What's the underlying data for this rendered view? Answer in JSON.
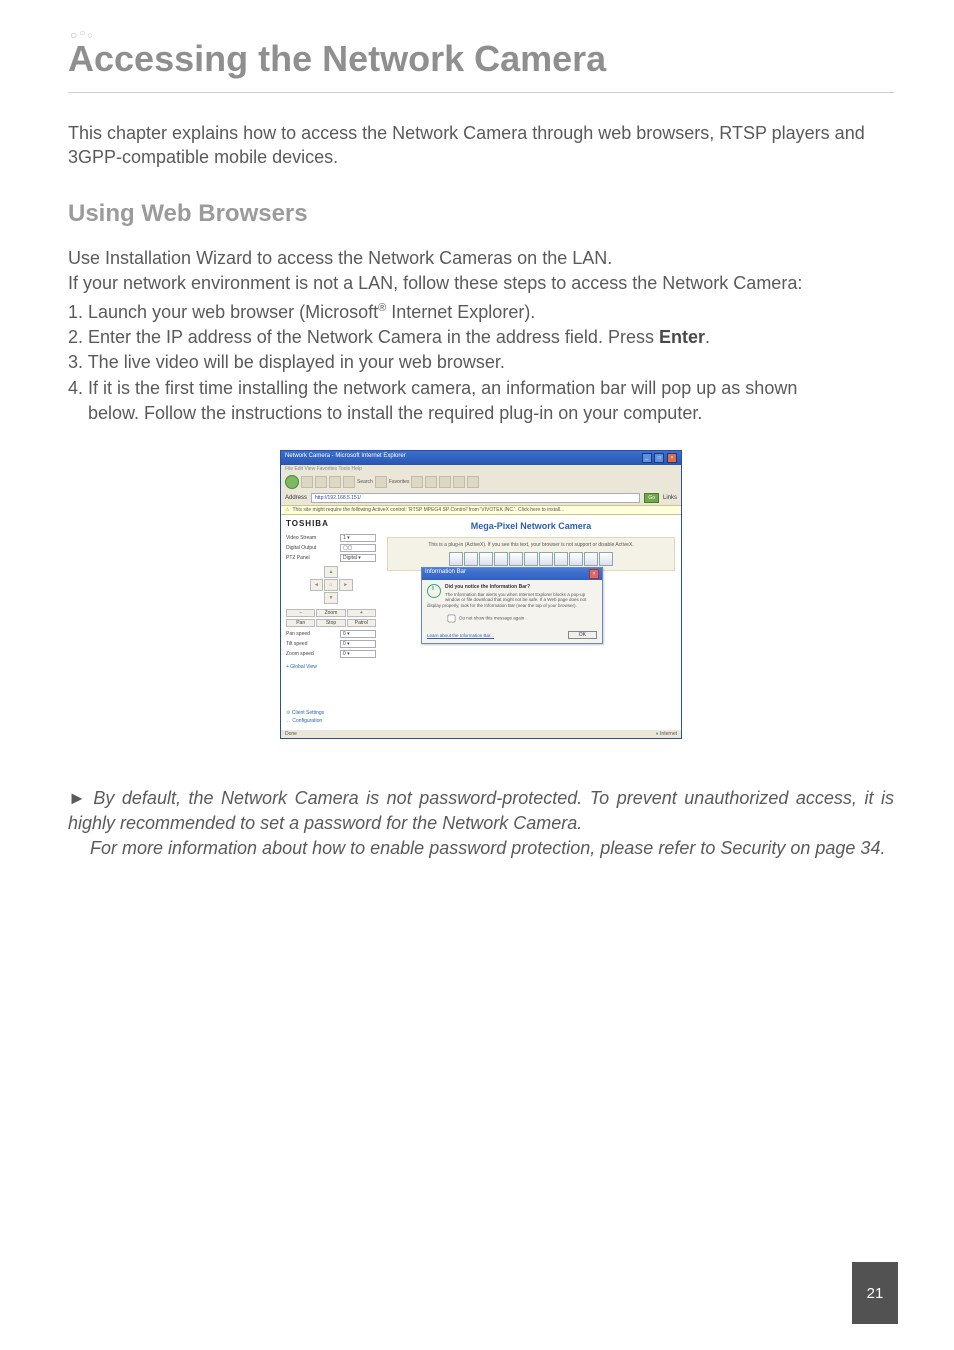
{
  "chapter_title": "Accessing the Network Camera",
  "intro_text": "This chapter explains how to access the Network Camera through web browsers, RTSP players and 3GPP-compatible mobile devices.",
  "section_title": "Using Web Browsers",
  "body_line1": "Use Installation Wizard to access the Network Cameras on the LAN.",
  "body_line2": "If your network environment is not a LAN, follow these steps to access the Network Camera:",
  "steps": {
    "s1_pre": "1. Launch your web browser (Microsoft",
    "s1_sup": "®",
    "s1_post": " Internet Explorer).",
    "s2_pre": "2. Enter the IP address of the Network Camera in the address field. Press ",
    "s2_bold": "Enter",
    "s2_post": ".",
    "s3": "3. The live video will be displayed in your web browser.",
    "s4a": "4. If it is the first time installing the network camera, an information bar will pop up as shown",
    "s4b": "below. Follow the instructions to install the required plug-in on your computer."
  },
  "screenshot": {
    "window_title": "Network Camera - Microsoft Internet Explorer",
    "menubar": "File   Edit   View   Favorites   Tools   Help",
    "toolbar": {
      "search": "Search",
      "favorites": "Favorites"
    },
    "address_label": "Address",
    "address_value": "http://192.168.5.151/",
    "go_label": "Go",
    "links_label": "Links",
    "infobar_text": "This site might require the following ActiveX control: 'RTSP MPEG4 SP Control' from 'VIVOTEK INC.'. Click here to install...",
    "sidebar": {
      "brand": "TOSHIBA",
      "video_stream_label": "Video Stream",
      "video_stream_value": "1",
      "digital_output_label": "Digital Output",
      "ptz_panel_label": "PTZ Panel",
      "ptz_panel_value": "Digital",
      "zoom_minus": "−",
      "zoom_label": "Zoom",
      "zoom_plus": "+",
      "pan_btn": "Pan",
      "stop_btn": "Stop",
      "patrol_btn": "Patrol",
      "pan_speed_label": "Pan speed",
      "pan_speed_value": "0",
      "tilt_speed_label": "Tilt speed",
      "tilt_speed_value": "0",
      "zoom_speed_label": "Zoom speed",
      "zoom_speed_value": "0",
      "global_view": "+ Global View",
      "client_settings": "Client Settings",
      "configuration": "Configuration"
    },
    "main": {
      "page_title": "Mega-Pixel Network Camera",
      "plugin_msg": "This is a plug-in (ActiveX). If you see this text, your browser is not support or disable ActiveX."
    },
    "dialog": {
      "title": "Information Bar",
      "heading": "Did you notice the Information Bar?",
      "text": "The Information Bar alerts you when Internet Explorer blocks a pop-up window or file download that might not be safe. If a Web page does not display properly, look for the Information Bar (near the top of your browser).",
      "checkbox": "Do not show this message again",
      "learn": "Learn about the Information Bar...",
      "ok": "OK"
    },
    "status_left": "Done",
    "status_right": "Internet"
  },
  "note": {
    "arrow": "►",
    "line1": "By default, the Network Camera is not password-protected. To prevent unauthorized access, it is highly recommended to set a password for the Network Camera.",
    "line2": "For more information about how to enable password protection, please refer to Security on page 34."
  },
  "page_number": "21"
}
